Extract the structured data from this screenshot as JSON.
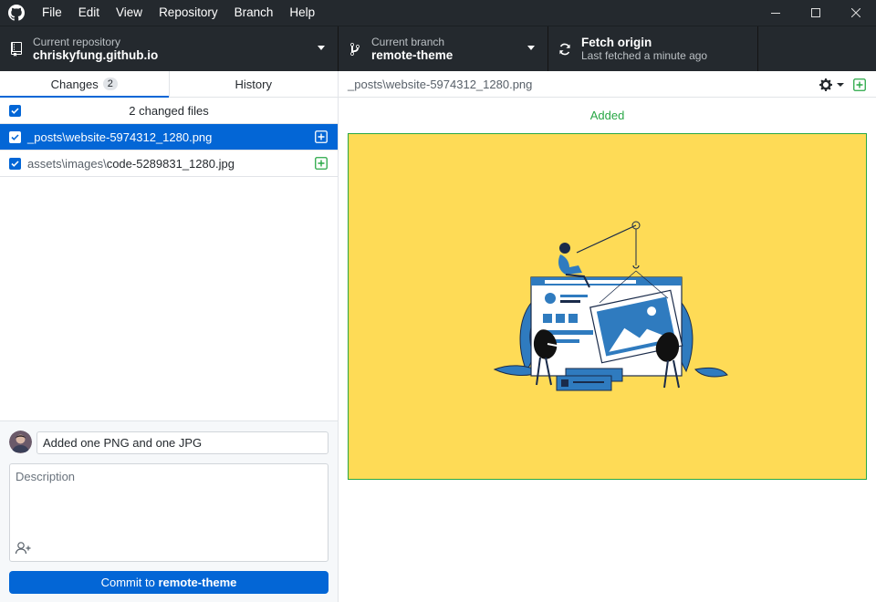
{
  "menu": [
    "File",
    "Edit",
    "View",
    "Repository",
    "Branch",
    "Help"
  ],
  "toolbar": {
    "repo_label": "Current repository",
    "repo_value": "chriskyfung.github.io",
    "branch_label": "Current branch",
    "branch_value": "remote-theme",
    "fetch_label": "Fetch origin",
    "fetch_sub": "Last fetched a minute ago"
  },
  "tabs": {
    "changes": "Changes",
    "changes_count": "2",
    "history": "History"
  },
  "changes": {
    "summary": "2 changed files",
    "files": [
      {
        "dir": "_posts\\",
        "name": "website-5974312_1280.png",
        "status": "added",
        "checked": true,
        "selected": true
      },
      {
        "dir": "assets\\images\\",
        "name": "code-5289831_1280.jpg",
        "status": "added",
        "checked": true,
        "selected": false
      }
    ]
  },
  "commit": {
    "summary_value": "Added one PNG and one JPG",
    "description_placeholder": "Description",
    "button_prefix": "Commit to ",
    "button_branch": "remote-theme"
  },
  "diff": {
    "path": "_posts\\website-5974312_1280.png",
    "status_label": "Added"
  },
  "colors": {
    "accent": "#0366d6",
    "added": "#28a745",
    "toolbar_bg": "#24292e",
    "image_bg": "#fedb56"
  }
}
